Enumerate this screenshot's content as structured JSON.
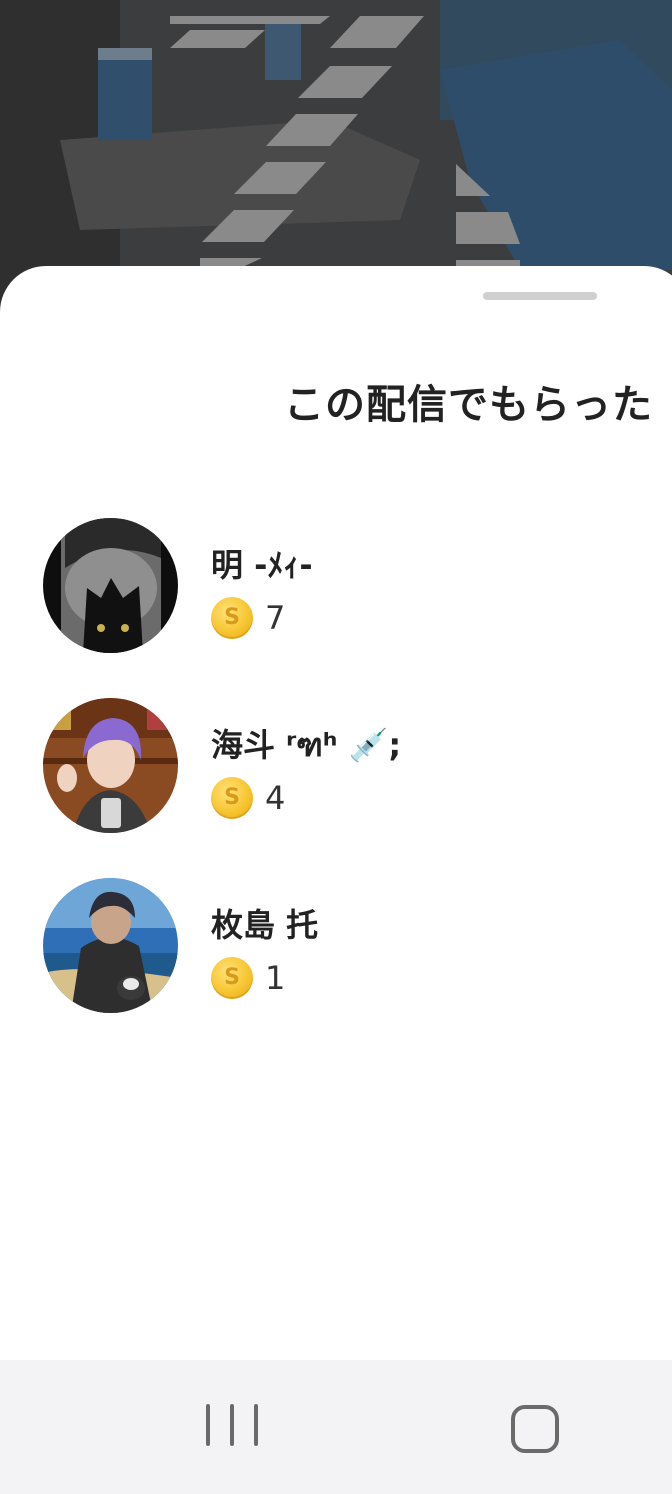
{
  "sheet": {
    "title": "この配信でもらった"
  },
  "gifters": [
    {
      "name": "明 -ﾒｨ-",
      "coin_icon": "coin-icon",
      "coin_symbol": "S",
      "count": "7",
      "avatar": "avatar-dark-cat"
    },
    {
      "name": "海斗 ʳฑʰ 💉;",
      "coin_icon": "coin-icon",
      "coin_symbol": "S",
      "count": "4",
      "avatar": "avatar-purple-hair"
    },
    {
      "name": "枚島 托",
      "coin_icon": "coin-icon",
      "coin_symbol": "S",
      "count": "1",
      "avatar": "avatar-beach"
    }
  ],
  "navigation": {
    "recents_icon": "recents-icon",
    "home_icon": "home-icon"
  },
  "colors": {
    "coin": "#f7c531",
    "title": "#222222",
    "navbar": "#f3f3f5"
  }
}
